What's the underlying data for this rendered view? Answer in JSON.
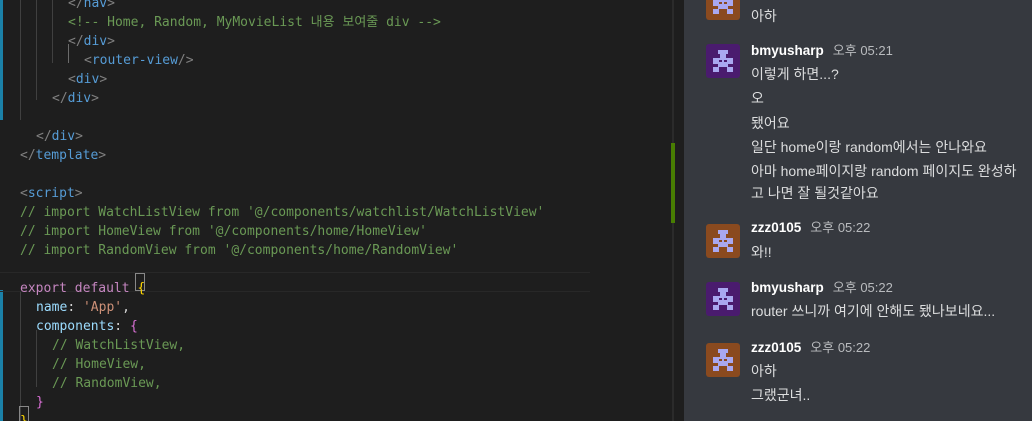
{
  "editor": {
    "lines": [
      {
        "tokens": [
          {
            "c": "c-punc",
            "t": "</"
          },
          {
            "c": "c-tag",
            "t": "nav"
          },
          {
            "c": "c-punc",
            "t": ">"
          }
        ]
      },
      {
        "tokens": [
          {
            "c": "c-cmt",
            "t": "<!-- Home, Random, MyMovieList 내용 보여줄 div -->"
          }
        ]
      },
      {
        "tokens": [
          {
            "c": "c-punc",
            "t": "</"
          },
          {
            "c": "c-tag",
            "t": "div"
          },
          {
            "c": "c-punc",
            "t": ">"
          }
        ]
      },
      {
        "tokens": [
          {
            "c": "c-punc",
            "t": "<"
          },
          {
            "c": "c-tag",
            "t": "router-view"
          },
          {
            "c": "c-punc",
            "t": "/>"
          }
        ]
      },
      {
        "tokens": [
          {
            "c": "c-punc",
            "t": "<"
          },
          {
            "c": "c-tag",
            "t": "div"
          },
          {
            "c": "c-punc",
            "t": ">"
          }
        ]
      },
      {
        "tokens": [
          {
            "c": "c-punc",
            "t": "</"
          },
          {
            "c": "c-tag",
            "t": "div"
          },
          {
            "c": "c-punc",
            "t": ">"
          }
        ]
      },
      {
        "tokens": []
      },
      {
        "tokens": [
          {
            "c": "c-punc",
            "t": "</"
          },
          {
            "c": "c-tag",
            "t": "div"
          },
          {
            "c": "c-punc",
            "t": ">"
          }
        ]
      },
      {
        "tokens": [
          {
            "c": "c-punc",
            "t": "</"
          },
          {
            "c": "c-tag",
            "t": "template"
          },
          {
            "c": "c-punc",
            "t": ">"
          }
        ]
      },
      {
        "tokens": []
      },
      {
        "tokens": [
          {
            "c": "c-punc",
            "t": "<"
          },
          {
            "c": "c-tag",
            "t": "script"
          },
          {
            "c": "c-punc",
            "t": ">"
          }
        ]
      },
      {
        "tokens": [
          {
            "c": "c-cmt",
            "t": "// import WatchListView from '@/components/watchlist/WatchListView'"
          }
        ]
      },
      {
        "tokens": [
          {
            "c": "c-cmt",
            "t": "// import HomeView from '@/components/home/HomeView'"
          }
        ]
      },
      {
        "tokens": [
          {
            "c": "c-cmt",
            "t": "// import RandomView from '@/components/home/RandomView'"
          }
        ]
      },
      {
        "tokens": []
      },
      {
        "tokens": [
          {
            "c": "c-kw2",
            "t": "export"
          },
          {
            "c": "c-text",
            "t": " "
          },
          {
            "c": "c-kw2",
            "t": "default"
          },
          {
            "c": "c-text",
            "t": " "
          },
          {
            "c": "c-brace",
            "t": "{"
          }
        ]
      },
      {
        "tokens": [
          {
            "c": "c-prop",
            "t": "name"
          },
          {
            "c": "c-text",
            "t": ": "
          },
          {
            "c": "c-str",
            "t": "'App'"
          },
          {
            "c": "c-text",
            "t": ","
          }
        ]
      },
      {
        "tokens": [
          {
            "c": "c-prop",
            "t": "components"
          },
          {
            "c": "c-text",
            "t": ": "
          },
          {
            "c": "c-brace2",
            "t": "{"
          }
        ]
      },
      {
        "tokens": [
          {
            "c": "c-cmt",
            "t": "// WatchListView,"
          }
        ]
      },
      {
        "tokens": [
          {
            "c": "c-cmt",
            "t": "// HomeView,"
          }
        ]
      },
      {
        "tokens": [
          {
            "c": "c-cmt",
            "t": "// RandomView,"
          }
        ]
      },
      {
        "tokens": [
          {
            "c": "c-brace2",
            "t": "}"
          }
        ]
      },
      {
        "tokens": [
          {
            "c": "c-brace",
            "t": "}"
          }
        ]
      }
    ]
  },
  "chat": {
    "messages": [
      {
        "username": "",
        "time": "",
        "avatar": "avatar-orange",
        "lines": [
          "아하"
        ]
      },
      {
        "username": "bmyusharp",
        "time": "오후 05:21",
        "avatar": "avatar-purple",
        "lines": [
          "이렇게 하면...?",
          "오",
          "됐어요",
          "일단 home이랑 random에서는 안나와요",
          "아마 home페이지랑 random 페이지도 완성하고 나면 잘 될것같아요"
        ]
      },
      {
        "username": "zzz0105",
        "time": "오후 05:22",
        "avatar": "avatar-orange",
        "lines": [
          "와!!"
        ]
      },
      {
        "username": "bmyusharp",
        "time": "오후 05:22",
        "avatar": "avatar-purple",
        "lines": [
          "router 쓰니까 여기에 안해도 됐나보네요..."
        ]
      },
      {
        "username": "zzz0105",
        "time": "오후 05:22",
        "avatar": "avatar-orange",
        "lines": [
          "아하",
          "그랬군녀.."
        ]
      }
    ],
    "colors": {
      "purple_avatar_bg": "#4a1b6e",
      "orange_avatar_bg": "#8a4a1f",
      "avatar_glyph": "#a9a8f0"
    }
  }
}
